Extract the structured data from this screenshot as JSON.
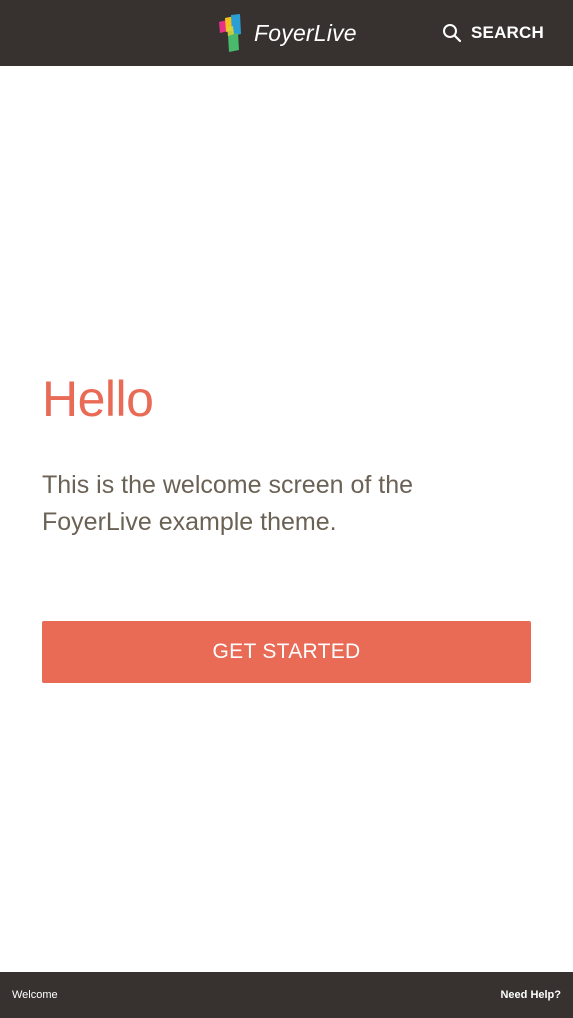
{
  "header": {
    "brand": "FoyerLive",
    "logo_icon": "foyerlive-logo-icon",
    "search_icon": "search-icon",
    "search_label": "SEARCH"
  },
  "main": {
    "title": "Hello",
    "description": "This is the welcome screen of the FoyerLive example theme.",
    "cta_label": "GET STARTED"
  },
  "footer": {
    "left_label": "Welcome",
    "right_label": "Need Help?"
  },
  "colors": {
    "header_bg": "#373230",
    "accent": "#e96a55",
    "body_text": "#6b6255",
    "background": "#ffffff"
  }
}
